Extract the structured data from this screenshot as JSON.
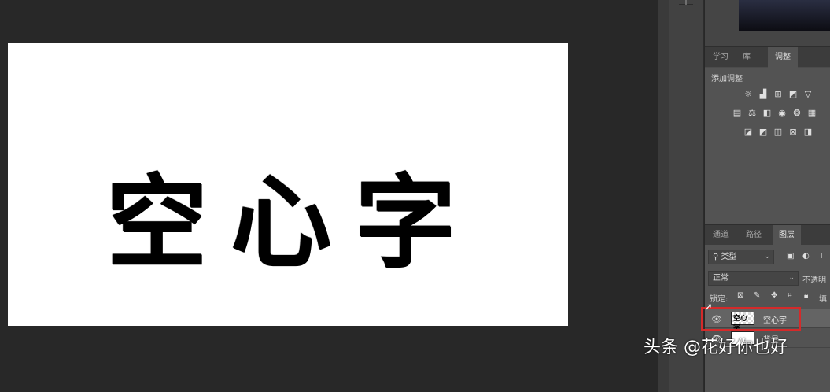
{
  "canvas": {
    "text": "空心字"
  },
  "panels": {
    "top_tabs": [
      "学习",
      "库",
      "调整"
    ],
    "adjustments_title": "添加调整",
    "adjustment_icon_rows": [
      [
        "brightness-icon",
        "levels-icon",
        "curves-icon",
        "exposure-icon",
        "vibrance-icon"
      ],
      [
        "hue-saturation-icon",
        "color-balance-icon",
        "black-white-icon",
        "photo-filter-icon",
        "channel-mixer-icon",
        "color-lookup-icon"
      ],
      [
        "invert-icon",
        "posterize-icon",
        "threshold-icon",
        "selective-color-icon",
        "gradient-map-icon"
      ]
    ],
    "bottom_tabs": [
      "通道",
      "路径",
      "图层"
    ]
  },
  "layers": {
    "filter_label": "类型",
    "blend_mode": "正常",
    "opacity_label": "不透明",
    "lock_label": "锁定:",
    "fill_label": "填",
    "items": [
      {
        "name": "空心字",
        "thumb_text": "空心字",
        "selected": true
      },
      {
        "name": "背景",
        "thumb_text": "",
        "selected": false
      }
    ]
  },
  "watermark": "头条 @花好你也好",
  "colors": {
    "workspace": "#282828",
    "panel": "#535353",
    "highlight": "#d42a2a"
  }
}
